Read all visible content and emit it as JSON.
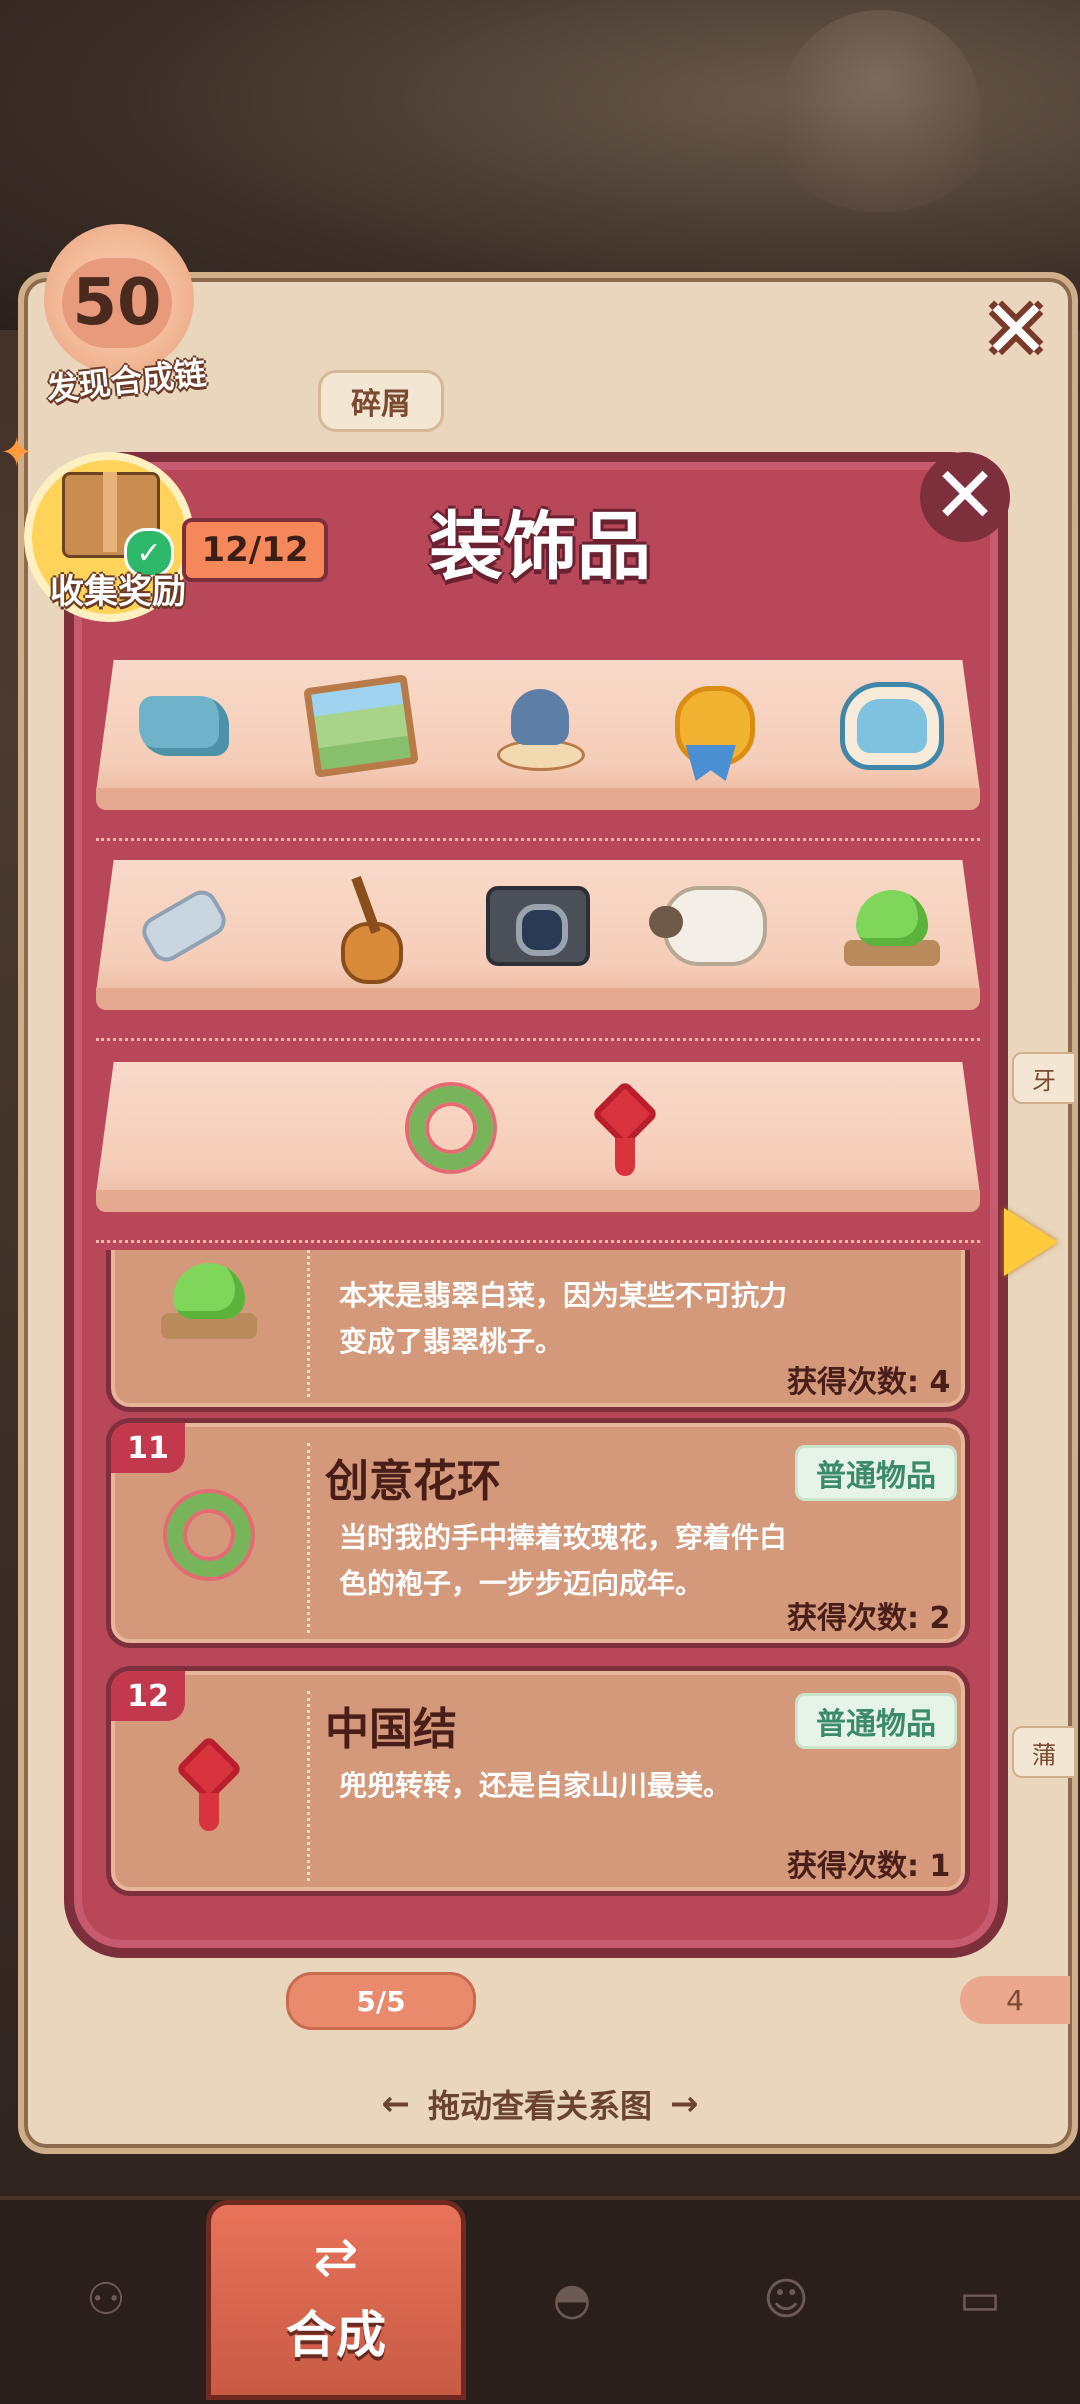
{
  "header": {
    "chain_count": "50",
    "chain_label": "发现合成链",
    "back_label": "碎屑"
  },
  "modal": {
    "title": "装饰品",
    "collected": "12/12",
    "collect_reward_label": "收集奖励"
  },
  "shelves": [
    [
      "puzzle-icon",
      "picture-icon",
      "dolphin-statue-icon",
      "medal-icon",
      "candy-box-icon"
    ],
    [
      "pipe-icon",
      "guitar-icon",
      "camera-icon",
      "sheep-icon",
      "jade-cabbage-icon"
    ],
    [
      "flower-wreath-icon",
      "chinese-knot-icon"
    ]
  ],
  "cards": [
    {
      "number": "",
      "name": "",
      "tag": "",
      "desc": "本来是翡翠白菜，因为某些不可抗力变成了翡翠桃子。",
      "count": "获得次数: 4",
      "icon": "jade-cabbage-icon"
    },
    {
      "number": "11",
      "name": "创意花环",
      "tag": "普通物品",
      "desc": "当时我的手中捧着玫瑰花，穿着件白色的袍子，一步步迈向成年。",
      "count": "获得次数: 2",
      "icon": "flower-wreath-icon"
    },
    {
      "number": "12",
      "name": "中国结",
      "tag": "普通物品",
      "desc": "兜兜转转，还是自家山川最美。",
      "count": "获得次数: 1",
      "icon": "chinese-knot-icon"
    }
  ],
  "footer": {
    "progress": "5/5",
    "progress_right": "4",
    "drag_hint": "拖动查看关系图",
    "arrow_left": "←",
    "arrow_right": "→"
  },
  "side_tabs": [
    "牙",
    "蒲"
  ],
  "nav": {
    "active_label": "合成",
    "items": [
      "bag-icon",
      "merge-icon",
      "bell-icon",
      "person-icon",
      "bus-icon"
    ]
  },
  "colors": {
    "modal": "#b9475a",
    "modal_border": "#7d2f3c",
    "tag_green": "#3b8a69",
    "accent_yellow": "#ffcb3d"
  }
}
